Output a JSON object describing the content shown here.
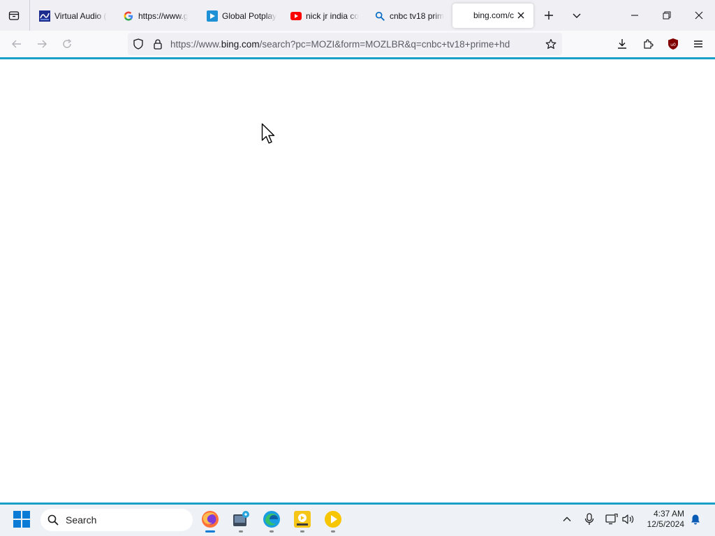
{
  "browser": {
    "tabs": [
      {
        "label": "Virtual Audio (",
        "icon": "audio-cable-icon",
        "active": false
      },
      {
        "label": "https://www.g",
        "icon": "google-icon",
        "active": false
      },
      {
        "label": "Global Potplay",
        "icon": "potplayer-icon",
        "active": false
      },
      {
        "label": "nick jr india co",
        "icon": "youtube-icon",
        "active": false
      },
      {
        "label": "cnbc tv18 prim",
        "icon": "search-icon",
        "active": false
      },
      {
        "label": "bing.com/c",
        "icon": "",
        "active": true
      }
    ],
    "url": {
      "prefix": "https://www.",
      "host": "bing.com",
      "path": "/search?pc=MOZI&form=MOZLBR&q=cnbc+tv18+prime+hd"
    },
    "accent_color": "#1aa0c8"
  },
  "taskbar": {
    "search_label": "Search",
    "apps": [
      "firefox-icon",
      "photo-viewer-icon",
      "edge-icon",
      "player-icon",
      "potplayer-icon"
    ],
    "clock": {
      "time": "4:37 AM",
      "date": "12/5/2024"
    }
  }
}
